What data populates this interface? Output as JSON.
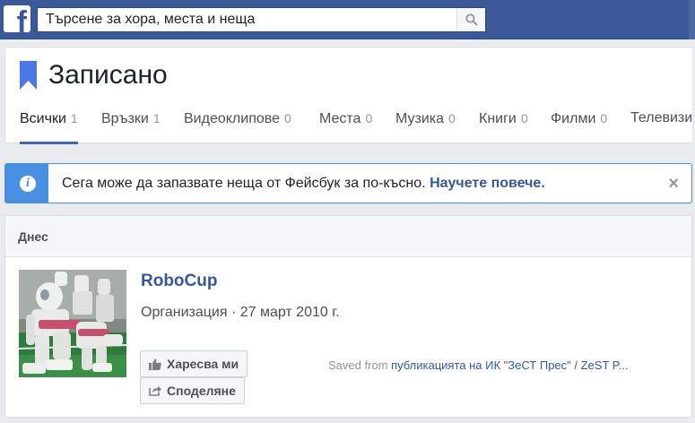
{
  "topbar": {
    "logo": "f",
    "search_placeholder": "Търсене за хора, места и неща",
    "icons": [
      "facebook-logo-icon",
      "search-icon"
    ],
    "brand_color": "#3b5998"
  },
  "header": {
    "title": "Записано",
    "icon": "bookmark-icon",
    "tabs": [
      {
        "label": "Всички",
        "count": "1",
        "active": true
      },
      {
        "label": "Връзки",
        "count": "1"
      },
      {
        "label": "Видеоклипове",
        "count": "0"
      },
      {
        "label": "Места",
        "count": "0"
      },
      {
        "label": "Музика",
        "count": "0"
      },
      {
        "label": "Книги",
        "count": "0"
      },
      {
        "label": "Филми",
        "count": "0"
      },
      {
        "label": "Телевизи",
        "count": ""
      }
    ]
  },
  "banner": {
    "icon": "info-icon",
    "text": "Сега може да запазвате неща от Фейсбук за по-късно.",
    "link": "Научете повече.",
    "close": "×",
    "accent_color": "#4a90e2"
  },
  "list": {
    "section_title": "Днес",
    "items": [
      {
        "title": "RoboCup",
        "meta": "Организация · 27 март 2010 г.",
        "like_label": "Харесва ми",
        "share_label": "Споделяне",
        "saved_from_prefix": "Saved from",
        "saved_from_link": "публикацията на ИК \"ЗеСТ Прес\" / ZeST P..."
      }
    ]
  }
}
